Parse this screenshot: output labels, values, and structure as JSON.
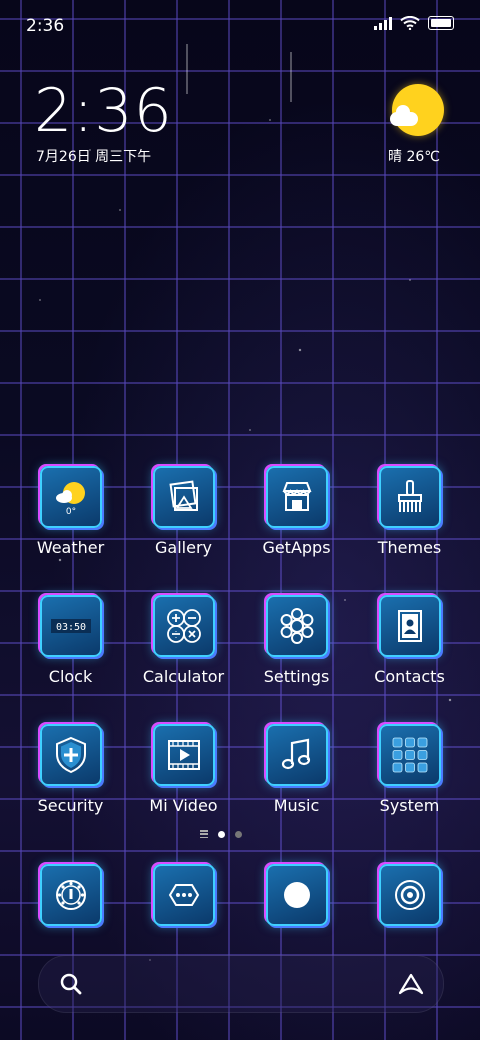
{
  "status": {
    "time": "2:36"
  },
  "widget": {
    "time": "2:36",
    "date": "7月26日 周三下午",
    "weather": "晴 26℃"
  },
  "apps": [
    {
      "label": "Weather",
      "icon": "weather-icon",
      "badge": "0°"
    },
    {
      "label": "Gallery",
      "icon": "gallery-icon"
    },
    {
      "label": "GetApps",
      "icon": "store-icon"
    },
    {
      "label": "Themes",
      "icon": "brush-icon"
    },
    {
      "label": "Clock",
      "icon": "clock-icon",
      "digits": "03:50"
    },
    {
      "label": "Calculator",
      "icon": "calculator-icon"
    },
    {
      "label": "Settings",
      "icon": "gear-icon"
    },
    {
      "label": "Contacts",
      "icon": "contacts-icon"
    },
    {
      "label": "Security",
      "icon": "shield-icon"
    },
    {
      "label": "Mi Video",
      "icon": "video-icon"
    },
    {
      "label": "Music",
      "icon": "music-icon"
    },
    {
      "label": "System",
      "icon": "folder-grid-icon"
    }
  ],
  "dock": [
    {
      "icon": "phone-dialer-icon"
    },
    {
      "icon": "messages-icon"
    },
    {
      "icon": "browser-icon"
    },
    {
      "icon": "camera-icon"
    }
  ]
}
